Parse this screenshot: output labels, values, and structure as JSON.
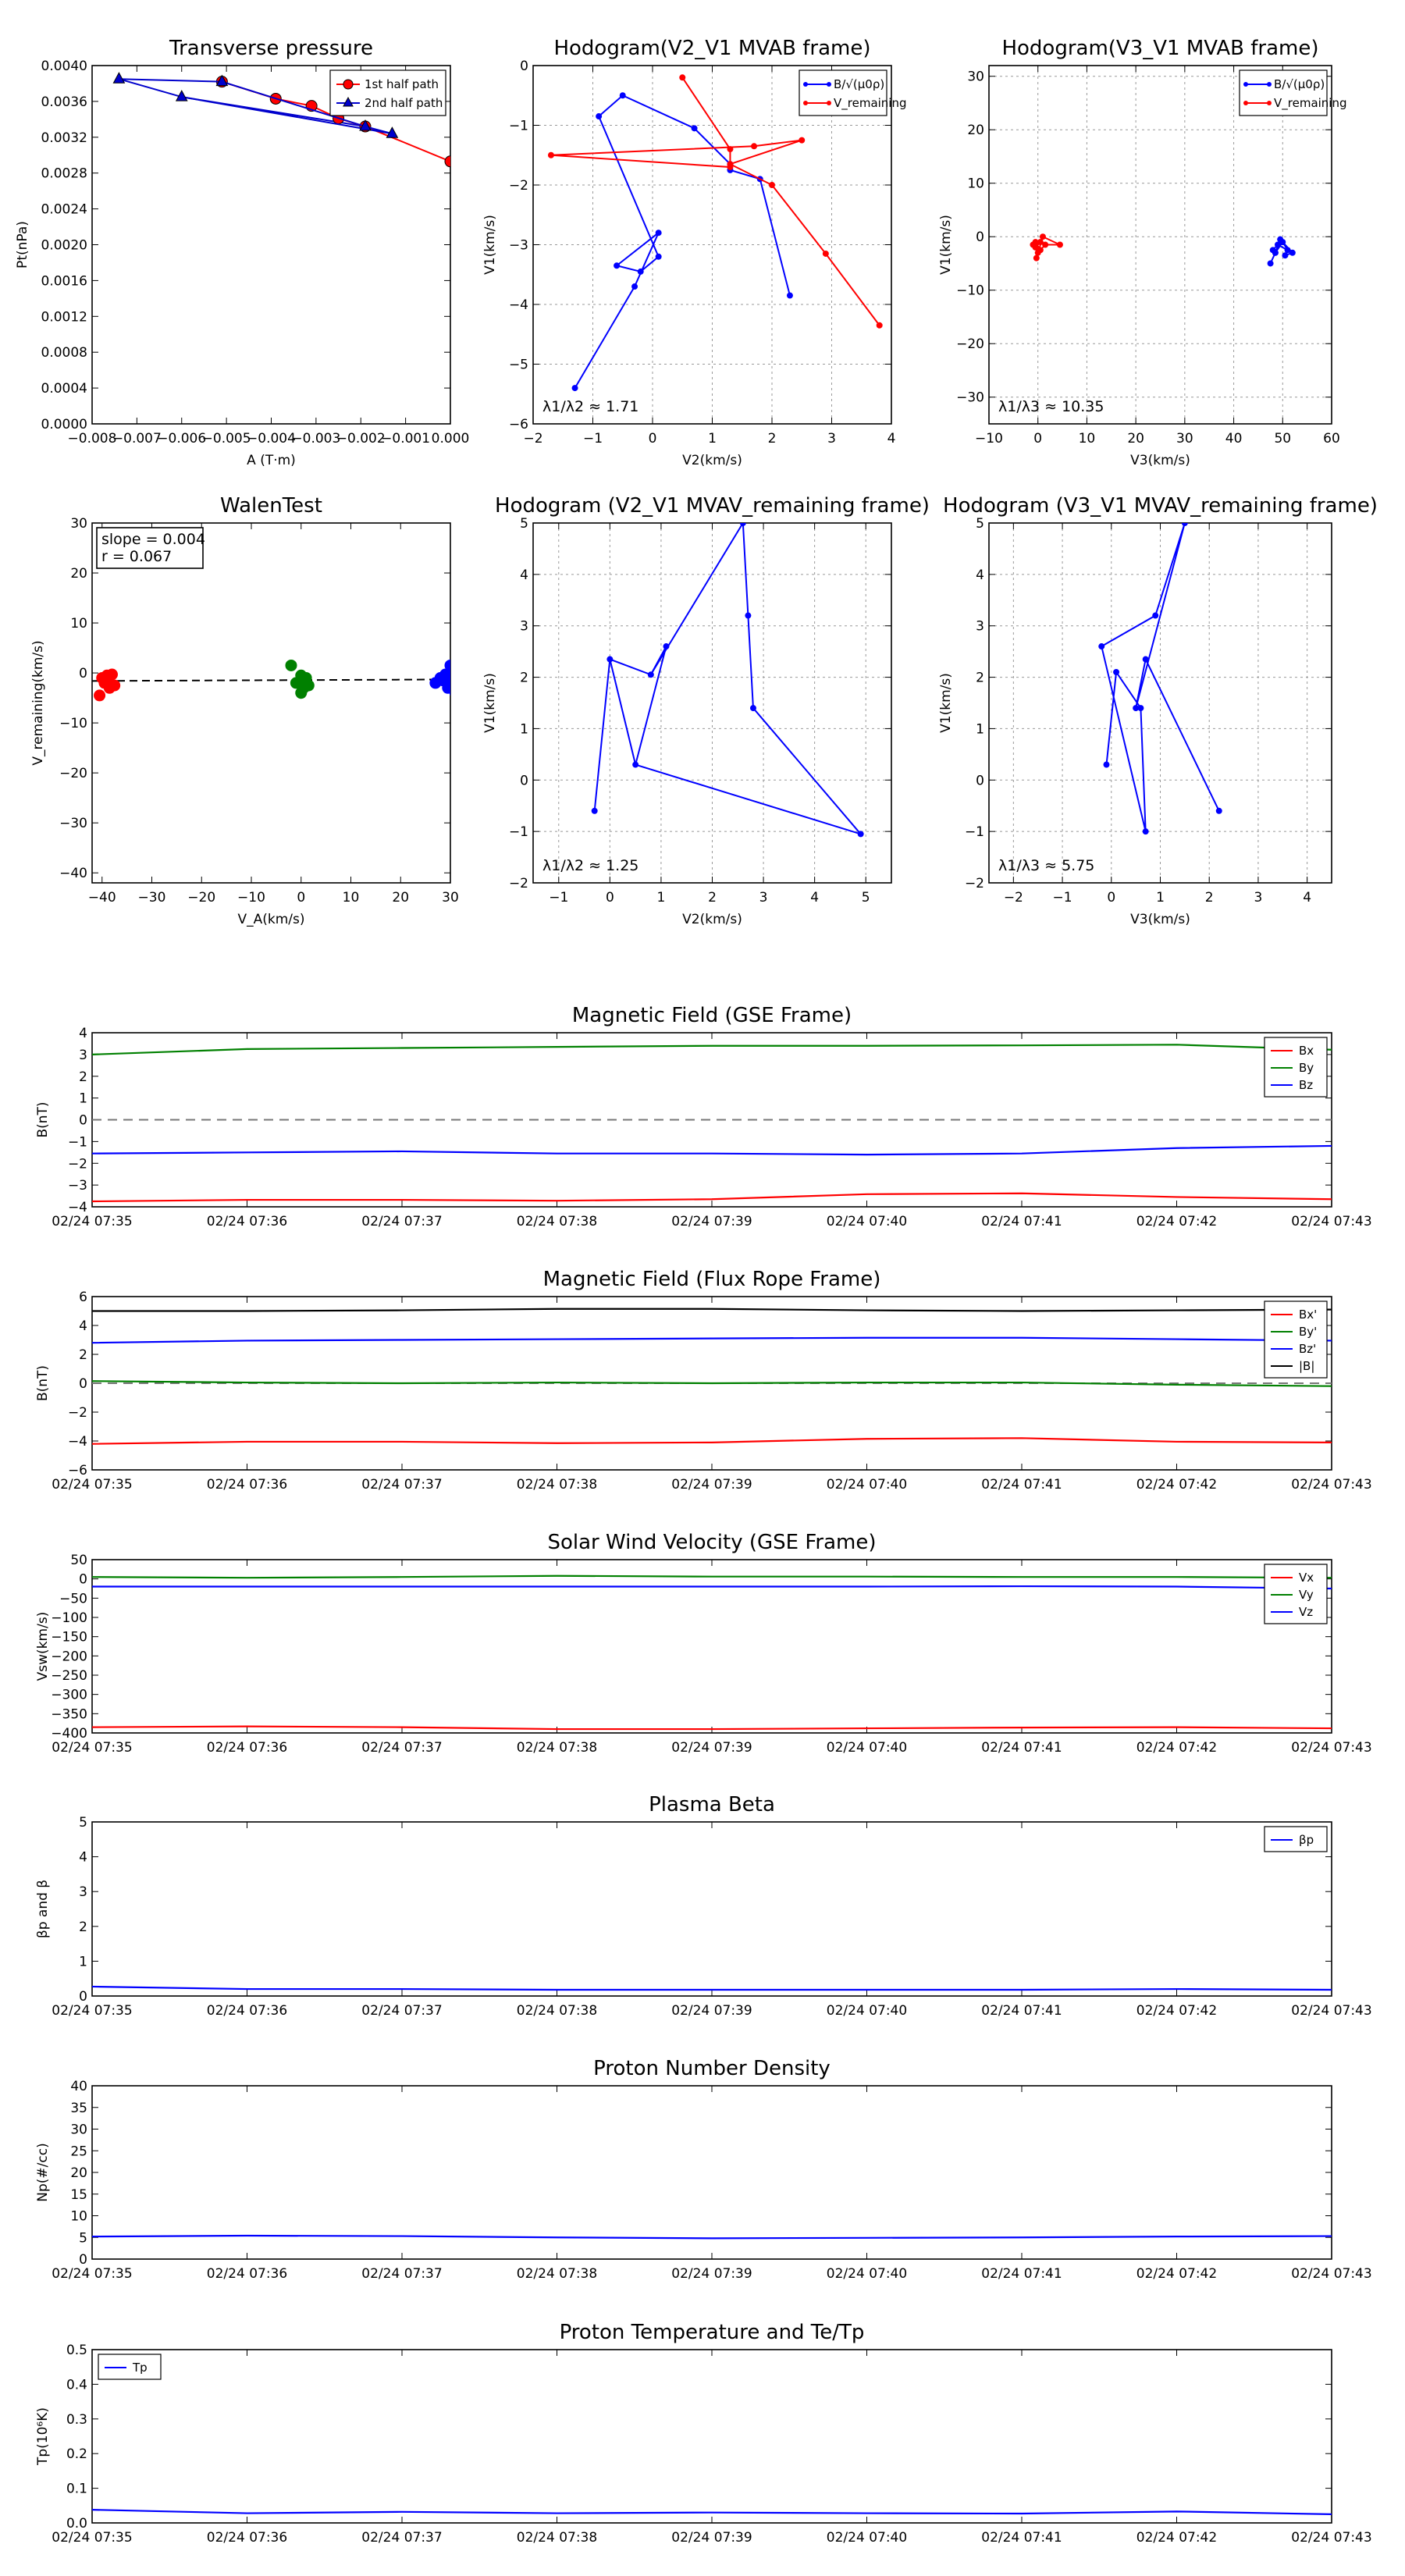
{
  "timeline": {
    "tick_labels": [
      "02/24 07:35",
      "02/24 07:36",
      "02/24 07:37",
      "02/24 07:38",
      "02/24 07:39",
      "02/24 07:40",
      "02/24 07:41",
      "02/24 07:42",
      "02/24 07:43"
    ]
  },
  "chart_data": [
    {
      "id": "transverse_pressure",
      "type": "line",
      "title": "Transverse pressure",
      "xlabel": "A (T·m)",
      "ylabel": "Pt(nPa)",
      "xlim": [
        -0.008,
        0.0
      ],
      "ylim": [
        0.0,
        0.004
      ],
      "xticks": [
        -0.008,
        -0.007,
        -0.006,
        -0.005,
        -0.004,
        -0.003,
        -0.002,
        -0.001,
        0.0
      ],
      "xtick_labels": [
        "−0.008",
        "−0.007",
        "−0.006",
        "−0.005",
        "−0.004",
        "−0.003",
        "−0.002",
        "−0.001",
        "0.000"
      ],
      "yticks": [
        0,
        0.0004,
        0.0008,
        0.0012,
        0.0016,
        0.002,
        0.0024,
        0.0028,
        0.0032,
        0.0036,
        0.004
      ],
      "ytick_labels": [
        "0.0000",
        "0.0004",
        "0.0008",
        "0.0012",
        "0.0016",
        "0.0020",
        "0.0024",
        "0.0028",
        "0.0032",
        "0.0036",
        "0.0040"
      ],
      "legend": "top-right",
      "series": [
        {
          "name": "1st half path",
          "color": "#ff0000",
          "marker": "circle",
          "x": [
            -0.0051,
            -0.0039,
            -0.0031,
            -0.0025,
            -0.0019,
            0.0
          ],
          "y": [
            0.00382,
            0.00363,
            0.00355,
            0.00341,
            0.00332,
            0.00293
          ]
        },
        {
          "name": "2nd half path",
          "color": "#0000cc",
          "marker": "triangle",
          "x": [
            -0.0074,
            -0.0051,
            -0.0019,
            -0.0013,
            -0.006
          ],
          "y": [
            0.00385,
            0.00382,
            0.00332,
            0.00324,
            0.00365
          ]
        }
      ],
      "extra_lines": [
        {
          "color": "#0000cc",
          "x": [
            -0.0074,
            -0.006,
            -0.0019
          ],
          "y": [
            0.00385,
            0.00365,
            0.00332
          ]
        }
      ]
    },
    {
      "id": "hodogram_mvab_v2v1",
      "type": "line",
      "title": "Hodogram(V2_V1 MVAB frame)",
      "xlabel": "V2(km/s)",
      "ylabel": "V1(km/s)",
      "xlim": [
        -2,
        4
      ],
      "ylim": [
        -6,
        0
      ],
      "xticks": [
        -2,
        -1,
        0,
        1,
        2,
        3,
        4
      ],
      "yticks": [
        -6,
        -5,
        -4,
        -3,
        -2,
        -1,
        0
      ],
      "grid": true,
      "legend": "top-right",
      "annotation": "λ1/λ2 ≈ 1.71",
      "series": [
        {
          "name": "B/√(μ0ρ)",
          "color": "#0000ff",
          "x": [
            -1.3,
            -0.3,
            0.1,
            -0.6,
            -0.2,
            0.1,
            -0.9,
            -0.5,
            0.7,
            1.3,
            1.3,
            1.8,
            2.3
          ],
          "y": [
            -5.4,
            -3.7,
            -2.8,
            -3.35,
            -3.45,
            -3.2,
            -0.85,
            -0.5,
            -1.05,
            -1.65,
            -1.75,
            -1.9,
            -3.85
          ]
        },
        {
          "name": "V_remaining",
          "color": "#ff0000",
          "x": [
            0.5,
            1.3,
            1.3,
            -1.7,
            1.7,
            2.5,
            1.3,
            2.0,
            2.9,
            3.8
          ],
          "y": [
            -0.2,
            -1.4,
            -1.7,
            -1.5,
            -1.35,
            -1.25,
            -1.65,
            -2.0,
            -3.15,
            -4.35
          ]
        }
      ]
    },
    {
      "id": "hodogram_mvab_v3v1",
      "type": "line",
      "title": "Hodogram(V3_V1 MVAB frame)",
      "xlabel": "V3(km/s)",
      "ylabel": "V1(km/s)",
      "xlim": [
        -10,
        60
      ],
      "ylim": [
        -35,
        32
      ],
      "xticks": [
        -10,
        0,
        10,
        20,
        30,
        40,
        50,
        60
      ],
      "yticks": [
        -30,
        -20,
        -10,
        0,
        10,
        20,
        30
      ],
      "grid": true,
      "legend": "top-right",
      "annotation": "λ1/λ3 ≈ 10.35",
      "series": [
        {
          "name": "B/√(μ0ρ)",
          "color": "#0000ff",
          "x": [
            47.5,
            48.5,
            48.0,
            49.0,
            51.0,
            50.0,
            48.5,
            49.5,
            52.0,
            50.5
          ],
          "y": [
            -5.0,
            -3.0,
            -2.5,
            -1.5,
            -2.5,
            -1.0,
            -3.0,
            -0.5,
            -3.0,
            -3.5
          ]
        },
        {
          "name": "V_remaining",
          "color": "#ff0000",
          "x": [
            -0.5,
            0.5,
            -0.3,
            1.0,
            4.5,
            1.5,
            0.0,
            -1.0,
            0.5,
            -0.5
          ],
          "y": [
            -1.0,
            -2.5,
            -4.0,
            0.0,
            -1.5,
            -1.5,
            -3.0,
            -1.5,
            -1.0,
            -2.0
          ]
        }
      ]
    },
    {
      "id": "walen_test",
      "type": "scatter",
      "title": "WalenTest",
      "xlabel": "V_A(km/s)",
      "ylabel": "V_remaining(km/s)",
      "xlim": [
        -42,
        30
      ],
      "ylim": [
        -42,
        30
      ],
      "xticks": [
        -40,
        -30,
        -20,
        -10,
        0,
        10,
        20,
        30
      ],
      "yticks": [
        -40,
        -30,
        -20,
        -10,
        0,
        10,
        20,
        30
      ],
      "legend_text": [
        "slope = 0.004",
        "r = 0.067"
      ],
      "fit_line": {
        "x": [
          -42,
          30
        ],
        "y": [
          -1.6,
          -1.3
        ]
      },
      "groups": [
        {
          "color": "#ff0000",
          "x": [
            -40,
            -39,
            -38,
            -39.5,
            -38.5,
            -37.5,
            -40.5,
            -39
          ],
          "y": [
            -1,
            -0.5,
            -0.3,
            -2,
            -3,
            -2.5,
            -4.5,
            -1.5
          ]
        },
        {
          "color": "#008000",
          "x": [
            -2,
            -1,
            0,
            1,
            0.5,
            -0.5,
            1.5,
            0
          ],
          "y": [
            1.5,
            -2,
            -0.5,
            -1,
            -3,
            -2,
            -2.5,
            -4
          ]
        },
        {
          "color": "#0000ff",
          "x": [
            27,
            28,
            29,
            30,
            30.5,
            29.5,
            28.5,
            31,
            30
          ],
          "y": [
            -2,
            -1,
            -0.3,
            1.5,
            -2.5,
            -3,
            -1.5,
            -4,
            -1
          ]
        }
      ]
    },
    {
      "id": "hodogram_mvav_v2v1",
      "type": "line",
      "title": "Hodogram (V2_V1 MVAV_remaining frame)",
      "xlabel": "V2(km/s)",
      "ylabel": "V1(km/s)",
      "xlim": [
        -1.5,
        5.5
      ],
      "ylim": [
        -2,
        5
      ],
      "xticks": [
        -1,
        0,
        1,
        2,
        3,
        4,
        5
      ],
      "yticks": [
        -2,
        -1,
        0,
        1,
        2,
        3,
        4,
        5
      ],
      "grid": true,
      "annotation": "λ1/λ2 ≈ 1.25",
      "series": [
        {
          "name": "",
          "color": "#0000ff",
          "x": [
            -0.3,
            0.0,
            0.8,
            1.1,
            0.5,
            4.9,
            2.8,
            2.7,
            2.6
          ],
          "y": [
            -0.6,
            2.35,
            2.05,
            2.6,
            0.3,
            -1.05,
            1.4,
            3.2,
            5.0
          ]
        }
      ],
      "extra_lines": [
        {
          "color": "#0000ff",
          "x": [
            0.0,
            0.5
          ],
          "y": [
            2.35,
            0.3
          ]
        },
        {
          "color": "#0000ff",
          "x": [
            0.8,
            2.6
          ],
          "y": [
            2.05,
            5.0
          ]
        }
      ]
    },
    {
      "id": "hodogram_mvav_v3v1",
      "type": "line",
      "title": "Hodogram (V3_V1 MVAV_remaining frame)",
      "xlabel": "V3(km/s)",
      "ylabel": "V1(km/s)",
      "xlim": [
        -2.5,
        4.5
      ],
      "ylim": [
        -2,
        5
      ],
      "xticks": [
        -2,
        -1,
        0,
        1,
        2,
        3,
        4
      ],
      "yticks": [
        -2,
        -1,
        0,
        1,
        2,
        3,
        4,
        5
      ],
      "grid": true,
      "annotation": "λ1/λ3 ≈ 5.75",
      "series": [
        {
          "name": "",
          "color": "#0000ff",
          "x": [
            -0.1,
            0.1,
            0.6,
            0.7,
            -0.2,
            0.9,
            1.5,
            0.5,
            0.7,
            2.2
          ],
          "y": [
            0.3,
            2.1,
            1.4,
            -1.0,
            2.6,
            3.2,
            5.0,
            1.4,
            2.35,
            -0.6
          ]
        }
      ]
    },
    {
      "id": "magnetic_field_gse",
      "type": "line",
      "title": "Magnetic Field (GSE Frame)",
      "ylabel": "B(nT)",
      "x_minutes": [
        0,
        1,
        2,
        3,
        4,
        5,
        6,
        7,
        8
      ],
      "ylim": [
        -4,
        4
      ],
      "yticks": [
        -4,
        -3,
        -2,
        -1,
        0,
        1,
        2,
        3,
        4
      ],
      "zero_line": true,
      "legend": "top-right",
      "series": [
        {
          "name": "Bx",
          "color": "#ff0000",
          "values": [
            -3.75,
            -3.68,
            -3.68,
            -3.72,
            -3.65,
            -3.42,
            -3.38,
            -3.55,
            -3.65
          ]
        },
        {
          "name": "By",
          "color": "#008000",
          "values": [
            3.0,
            3.25,
            3.3,
            3.35,
            3.4,
            3.4,
            3.42,
            3.45,
            3.22
          ]
        },
        {
          "name": "Bz",
          "color": "#0000ff",
          "values": [
            -1.55,
            -1.5,
            -1.45,
            -1.55,
            -1.55,
            -1.6,
            -1.55,
            -1.3,
            -1.2
          ]
        }
      ]
    },
    {
      "id": "magnetic_field_flux_rope",
      "type": "line",
      "title": "Magnetic Field (Flux Rope Frame)",
      "ylabel": "B(nT)",
      "x_minutes": [
        0,
        1,
        2,
        3,
        4,
        5,
        6,
        7,
        8
      ],
      "ylim": [
        -6,
        6
      ],
      "yticks": [
        -6,
        -4,
        -2,
        0,
        2,
        4,
        6
      ],
      "zero_line": true,
      "legend": "top-right",
      "series": [
        {
          "name": "Bx'",
          "color": "#ff0000",
          "values": [
            -4.2,
            -4.05,
            -4.05,
            -4.15,
            -4.1,
            -3.85,
            -3.8,
            -4.05,
            -4.1
          ]
        },
        {
          "name": "By'",
          "color": "#008000",
          "values": [
            0.15,
            0.05,
            0.0,
            0.05,
            0.0,
            0.05,
            0.05,
            -0.1,
            -0.2
          ]
        },
        {
          "name": "Bz'",
          "color": "#0000ff",
          "values": [
            2.8,
            2.95,
            3.0,
            3.05,
            3.1,
            3.15,
            3.15,
            3.05,
            2.95
          ]
        },
        {
          "name": "|B|",
          "color": "#000000",
          "values": [
            5.0,
            5.0,
            5.05,
            5.15,
            5.15,
            5.05,
            5.0,
            5.05,
            5.1
          ]
        }
      ]
    },
    {
      "id": "solar_wind_velocity",
      "type": "line",
      "title": "Solar Wind Velocity (GSE Frame)",
      "ylabel": "Vsw(km/s)",
      "x_minutes": [
        0,
        1,
        2,
        3,
        4,
        5,
        6,
        7,
        8
      ],
      "ylim": [
        -400,
        50
      ],
      "yticks": [
        -400,
        -350,
        -300,
        -250,
        -200,
        -150,
        -100,
        -50,
        0,
        50
      ],
      "legend": "top-right",
      "series": [
        {
          "name": "Vx",
          "color": "#ff0000",
          "values": [
            -385,
            -383,
            -385,
            -390,
            -390,
            -388,
            -386,
            -385,
            -388
          ]
        },
        {
          "name": "Vy",
          "color": "#008000",
          "values": [
            5,
            3,
            5,
            8,
            6,
            6,
            5,
            5,
            3
          ]
        },
        {
          "name": "Vz",
          "color": "#0000ff",
          "values": [
            -20,
            -20,
            -20,
            -20,
            -20,
            -20,
            -19,
            -20,
            -25
          ]
        }
      ]
    },
    {
      "id": "plasma_beta",
      "type": "line",
      "title": "Plasma Beta",
      "ylabel": "βp and β",
      "x_minutes": [
        0,
        1,
        2,
        3,
        4,
        5,
        6,
        7,
        8
      ],
      "ylim": [
        0,
        5
      ],
      "yticks": [
        0,
        1,
        2,
        3,
        4,
        5
      ],
      "legend": "top-right",
      "series": [
        {
          "name": "βp",
          "color": "#0000ff",
          "values": [
            0.27,
            0.2,
            0.2,
            0.18,
            0.18,
            0.18,
            0.18,
            0.2,
            0.18
          ]
        }
      ]
    },
    {
      "id": "proton_density",
      "type": "line",
      "title": "Proton Number Density",
      "ylabel": "Np(#/cc)",
      "x_minutes": [
        0,
        1,
        2,
        3,
        4,
        5,
        6,
        7,
        8
      ],
      "ylim": [
        0,
        40
      ],
      "yticks": [
        0,
        5,
        10,
        15,
        20,
        25,
        30,
        35,
        40
      ],
      "series": [
        {
          "name": "",
          "color": "#0000ff",
          "values": [
            5.2,
            5.4,
            5.3,
            5.0,
            4.8,
            4.9,
            5.0,
            5.2,
            5.3
          ]
        }
      ]
    },
    {
      "id": "proton_temperature",
      "type": "line",
      "title": "Proton Temperature and Te/Tp",
      "ylabel": "Tp(10⁶K)",
      "x_minutes": [
        0,
        1,
        2,
        3,
        4,
        5,
        6,
        7,
        8
      ],
      "ylim": [
        0,
        0.5
      ],
      "yticks": [
        0,
        0.1,
        0.2,
        0.3,
        0.4,
        0.5
      ],
      "ytick_labels": [
        "0.0",
        "0.1",
        "0.2",
        "0.3",
        "0.4",
        "0.5"
      ],
      "legend": "top-left",
      "series": [
        {
          "name": "Tp",
          "color": "#0000ff",
          "values": [
            0.038,
            0.028,
            0.032,
            0.028,
            0.03,
            0.028,
            0.027,
            0.033,
            0.025
          ]
        }
      ]
    }
  ]
}
